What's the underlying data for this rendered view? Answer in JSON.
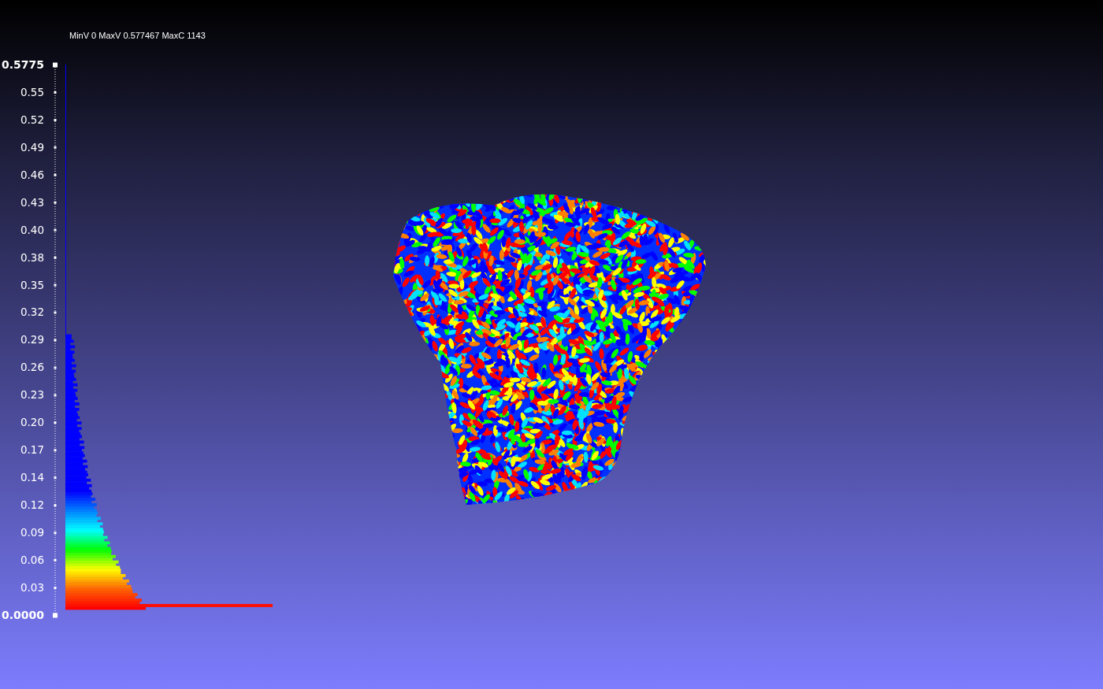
{
  "viewport": {
    "info_text": "MinV 0 MaxV 0.577467 MaxC 1143",
    "scale_labels": [
      "0.5775",
      "0.55",
      "0.52",
      "0.49",
      "0.46",
      "0.43",
      "0.40",
      "0.38",
      "0.35",
      "0.32",
      "0.29",
      "0.26",
      "0.23",
      "0.20",
      "0.17",
      "0.14",
      "0.12",
      "0.09",
      "0.06",
      "0.03",
      "0.0000"
    ]
  }
}
